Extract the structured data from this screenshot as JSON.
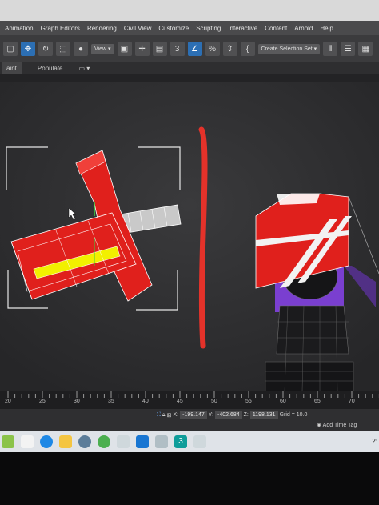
{
  "menu": [
    "Animation",
    "Graph Editors",
    "Rendering",
    "Civil View",
    "Customize",
    "Scripting",
    "Interactive",
    "Content",
    "Arnold",
    "Help"
  ],
  "toolbar": {
    "view_dropdown": "View",
    "selection_set_dropdown": "Create Selection Set",
    "angle_snap_label": "3",
    "percent_label": "%"
  },
  "ribbon": {
    "tab_paint": "aint",
    "tab_populate": "Populate"
  },
  "timeline": {
    "ticks": [
      "20",
      "25",
      "30",
      "35",
      "40",
      "45",
      "50",
      "55",
      "60",
      "65",
      "70"
    ]
  },
  "status": {
    "x_label": "X:",
    "x_value": "-199.147",
    "y_label": "Y:",
    "y_value": "-402.684",
    "z_label": "Z:",
    "z_value": "1198.131",
    "grid": "Grid = 10.0",
    "add_time_tag": "Add Time Tag"
  },
  "taskbar": {
    "clock": "2:"
  },
  "colors": {
    "object_red": "#e0201c",
    "highlight_yellow": "#f2f000",
    "annotation_red": "#e4322a",
    "purple": "#7a3fd0",
    "accent_blue": "#2c6fb4"
  },
  "icons": [
    "select-icon",
    "move-icon",
    "rotate-icon",
    "scale-icon",
    "snap-icon",
    "percent-snap-icon",
    "curly-brace-icon",
    "mirror-icon",
    "align-icon",
    "layer-icon"
  ]
}
